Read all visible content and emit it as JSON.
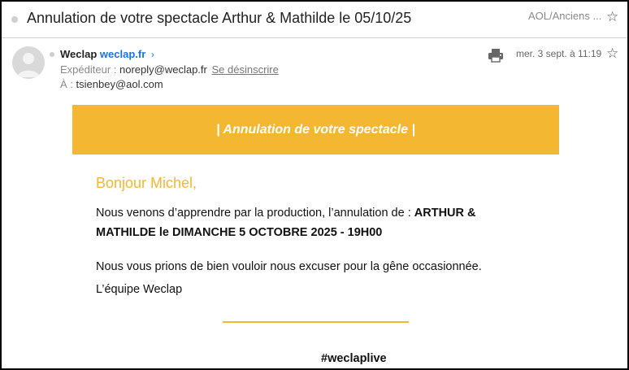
{
  "header": {
    "subject": "Annulation de votre spectacle Arthur & Mathilde le 05/10/25",
    "folder": "AOL/Anciens ...",
    "star_icon": "star-outline-icon"
  },
  "message": {
    "sender_name": "Weclap",
    "sender_domain": "weclap.fr",
    "chevron": "›",
    "from_label": "Expéditeur :",
    "from_address": "noreply@weclap.fr",
    "unsubscribe": "Se désinscrire",
    "to_label": "À :",
    "to_address": "tsienbey@aol.com",
    "date": "mer. 3 sept. à 11:19",
    "print_icon": "printer-icon",
    "avatar_icon": "default-avatar-icon"
  },
  "email": {
    "banner": "| Annulation de votre spectacle |",
    "greeting": "Bonjour Michel,",
    "p1_text": "Nous venons d’apprendre par la production,  l’annulation de : ",
    "p1_bold": "ARTHUR & MATHILDE  le  DIMANCHE 5 OCTOBRE 2025 - 19H00",
    "p2": "Nous vous prions de bien vouloir nous excuser pour  la gêne occasionnée.",
    "signature": "L’équipe Weclap",
    "hashtag": "#weclaplive"
  },
  "colors": {
    "accent": "#f4b731",
    "link": "#1a73e8"
  }
}
